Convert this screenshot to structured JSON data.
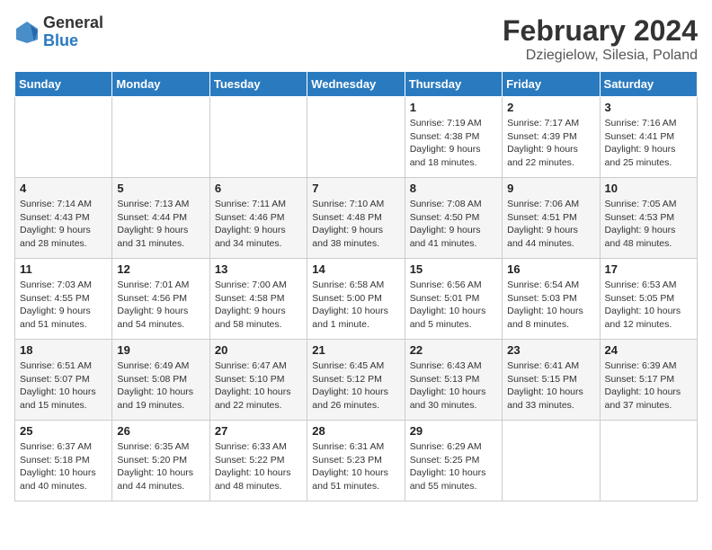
{
  "header": {
    "logo_general": "General",
    "logo_blue": "Blue",
    "title": "February 2024",
    "subtitle": "Dziegielow, Silesia, Poland"
  },
  "weekdays": [
    "Sunday",
    "Monday",
    "Tuesday",
    "Wednesday",
    "Thursday",
    "Friday",
    "Saturday"
  ],
  "weeks": [
    [
      {
        "date": "",
        "info": ""
      },
      {
        "date": "",
        "info": ""
      },
      {
        "date": "",
        "info": ""
      },
      {
        "date": "",
        "info": ""
      },
      {
        "date": "1",
        "info": "Sunrise: 7:19 AM\nSunset: 4:38 PM\nDaylight: 9 hours\nand 18 minutes."
      },
      {
        "date": "2",
        "info": "Sunrise: 7:17 AM\nSunset: 4:39 PM\nDaylight: 9 hours\nand 22 minutes."
      },
      {
        "date": "3",
        "info": "Sunrise: 7:16 AM\nSunset: 4:41 PM\nDaylight: 9 hours\nand 25 minutes."
      }
    ],
    [
      {
        "date": "4",
        "info": "Sunrise: 7:14 AM\nSunset: 4:43 PM\nDaylight: 9 hours\nand 28 minutes."
      },
      {
        "date": "5",
        "info": "Sunrise: 7:13 AM\nSunset: 4:44 PM\nDaylight: 9 hours\nand 31 minutes."
      },
      {
        "date": "6",
        "info": "Sunrise: 7:11 AM\nSunset: 4:46 PM\nDaylight: 9 hours\nand 34 minutes."
      },
      {
        "date": "7",
        "info": "Sunrise: 7:10 AM\nSunset: 4:48 PM\nDaylight: 9 hours\nand 38 minutes."
      },
      {
        "date": "8",
        "info": "Sunrise: 7:08 AM\nSunset: 4:50 PM\nDaylight: 9 hours\nand 41 minutes."
      },
      {
        "date": "9",
        "info": "Sunrise: 7:06 AM\nSunset: 4:51 PM\nDaylight: 9 hours\nand 44 minutes."
      },
      {
        "date": "10",
        "info": "Sunrise: 7:05 AM\nSunset: 4:53 PM\nDaylight: 9 hours\nand 48 minutes."
      }
    ],
    [
      {
        "date": "11",
        "info": "Sunrise: 7:03 AM\nSunset: 4:55 PM\nDaylight: 9 hours\nand 51 minutes."
      },
      {
        "date": "12",
        "info": "Sunrise: 7:01 AM\nSunset: 4:56 PM\nDaylight: 9 hours\nand 54 minutes."
      },
      {
        "date": "13",
        "info": "Sunrise: 7:00 AM\nSunset: 4:58 PM\nDaylight: 9 hours\nand 58 minutes."
      },
      {
        "date": "14",
        "info": "Sunrise: 6:58 AM\nSunset: 5:00 PM\nDaylight: 10 hours\nand 1 minute."
      },
      {
        "date": "15",
        "info": "Sunrise: 6:56 AM\nSunset: 5:01 PM\nDaylight: 10 hours\nand 5 minutes."
      },
      {
        "date": "16",
        "info": "Sunrise: 6:54 AM\nSunset: 5:03 PM\nDaylight: 10 hours\nand 8 minutes."
      },
      {
        "date": "17",
        "info": "Sunrise: 6:53 AM\nSunset: 5:05 PM\nDaylight: 10 hours\nand 12 minutes."
      }
    ],
    [
      {
        "date": "18",
        "info": "Sunrise: 6:51 AM\nSunset: 5:07 PM\nDaylight: 10 hours\nand 15 minutes."
      },
      {
        "date": "19",
        "info": "Sunrise: 6:49 AM\nSunset: 5:08 PM\nDaylight: 10 hours\nand 19 minutes."
      },
      {
        "date": "20",
        "info": "Sunrise: 6:47 AM\nSunset: 5:10 PM\nDaylight: 10 hours\nand 22 minutes."
      },
      {
        "date": "21",
        "info": "Sunrise: 6:45 AM\nSunset: 5:12 PM\nDaylight: 10 hours\nand 26 minutes."
      },
      {
        "date": "22",
        "info": "Sunrise: 6:43 AM\nSunset: 5:13 PM\nDaylight: 10 hours\nand 30 minutes."
      },
      {
        "date": "23",
        "info": "Sunrise: 6:41 AM\nSunset: 5:15 PM\nDaylight: 10 hours\nand 33 minutes."
      },
      {
        "date": "24",
        "info": "Sunrise: 6:39 AM\nSunset: 5:17 PM\nDaylight: 10 hours\nand 37 minutes."
      }
    ],
    [
      {
        "date": "25",
        "info": "Sunrise: 6:37 AM\nSunset: 5:18 PM\nDaylight: 10 hours\nand 40 minutes."
      },
      {
        "date": "26",
        "info": "Sunrise: 6:35 AM\nSunset: 5:20 PM\nDaylight: 10 hours\nand 44 minutes."
      },
      {
        "date": "27",
        "info": "Sunrise: 6:33 AM\nSunset: 5:22 PM\nDaylight: 10 hours\nand 48 minutes."
      },
      {
        "date": "28",
        "info": "Sunrise: 6:31 AM\nSunset: 5:23 PM\nDaylight: 10 hours\nand 51 minutes."
      },
      {
        "date": "29",
        "info": "Sunrise: 6:29 AM\nSunset: 5:25 PM\nDaylight: 10 hours\nand 55 minutes."
      },
      {
        "date": "",
        "info": ""
      },
      {
        "date": "",
        "info": ""
      }
    ]
  ]
}
